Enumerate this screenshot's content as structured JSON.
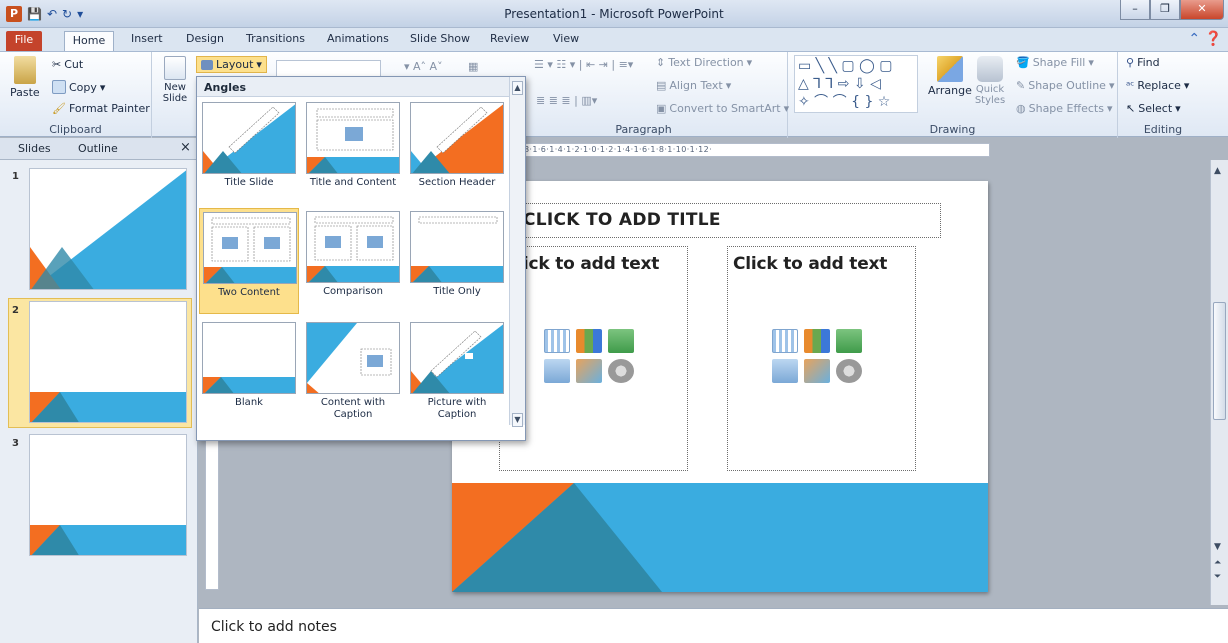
{
  "window": {
    "title": "Presentation1 - Microsoft PowerPoint",
    "minimize": "–",
    "maximize": "❐",
    "close": "✕"
  },
  "tabs": [
    "File",
    "Home",
    "Insert",
    "Design",
    "Transitions",
    "Animations",
    "Slide Show",
    "Review",
    "View"
  ],
  "ribbon": {
    "clipboard": {
      "label": "Clipboard",
      "paste": "Paste",
      "cut": "Cut",
      "copy": "Copy",
      "format_painter": "Format Painter"
    },
    "slides": {
      "new_slide": "New Slide",
      "layout": "Layout"
    },
    "paragraph": {
      "label": "Paragraph",
      "text_direction": "Text Direction",
      "align_text": "Align Text",
      "convert_smartart": "Convert to SmartArt"
    },
    "drawing": {
      "label": "Drawing",
      "arrange": "Arrange",
      "quick_styles": "Quick Styles",
      "shape_fill": "Shape Fill",
      "shape_outline": "Shape Outline",
      "shape_effects": "Shape Effects"
    },
    "editing": {
      "label": "Editing",
      "find": "Find",
      "replace": "Replace",
      "select": "Select"
    }
  },
  "slides_pane": {
    "tab_slides": "Slides",
    "tab_outline": "Outline",
    "close": "×",
    "thumbs": [
      "1",
      "2",
      "3"
    ]
  },
  "layout_gallery": {
    "heading": "Angles",
    "items": [
      "Title Slide",
      "Title and Content",
      "Section Header",
      "Two Content",
      "Comparison",
      "Title Only",
      "Blank",
      "Content with Caption",
      "Picture with Caption"
    ]
  },
  "slide": {
    "title_placeholder": "CLICK TO ADD TITLE",
    "left_text": "Click to add text",
    "right_text": "Click to add text"
  },
  "ruler_text": "·8·1·6·1·4·1·2·1·0·1·2·1·4·1·6·1·8·1·10·1·12·",
  "notes": "Click to add notes",
  "colors": {
    "accent_blue": "#3aace0",
    "accent_orange": "#f36e21",
    "dark_teal": "#2f8aa9",
    "file_tab": "#c4432b"
  }
}
